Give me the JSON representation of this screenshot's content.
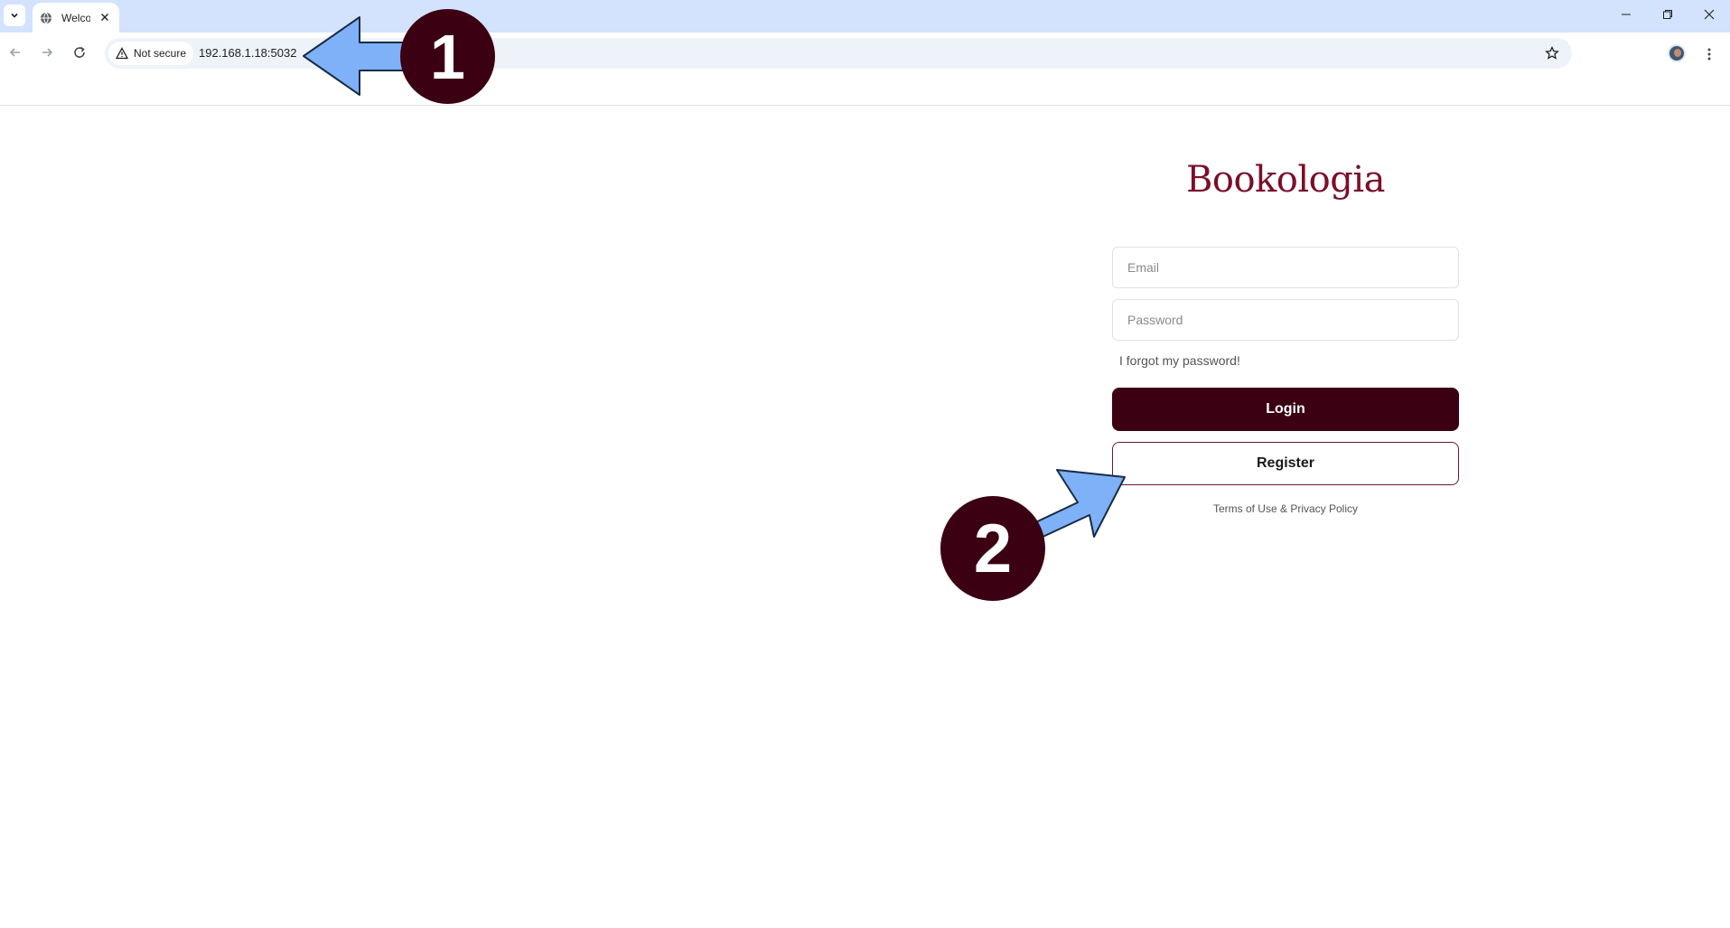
{
  "browser": {
    "tab_title": "Welcome",
    "security_chip": "Not secure",
    "url": "192.168.1.18:5032"
  },
  "page": {
    "logo": "Bookologia",
    "email_placeholder": "Email",
    "password_placeholder": "Password",
    "forgot_link": "I forgot my password!",
    "login_button": "Login",
    "register_button": "Register",
    "terms_link": "Terms of Use",
    "terms_sep": " & ",
    "privacy_link": "Privacy Policy"
  },
  "annotations": {
    "step1": "1",
    "step2": "2"
  },
  "colors": {
    "brand": "#7a0f2a",
    "primary_button": "#3b0012",
    "annotation_arrow": "#7eb1f7"
  }
}
